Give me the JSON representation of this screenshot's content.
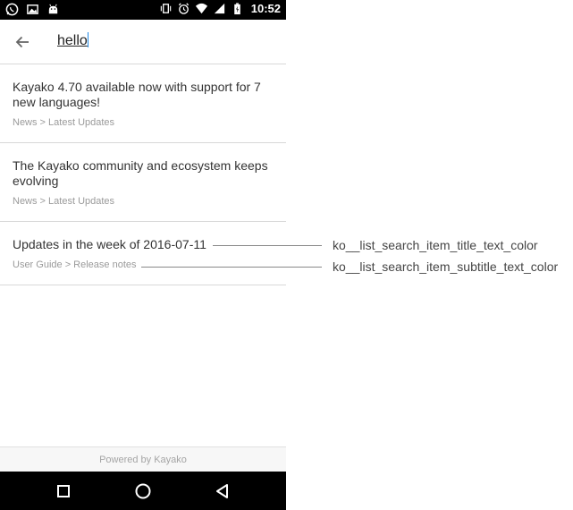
{
  "status_bar": {
    "time": "10:52",
    "left_icons": [
      "whatsapp-icon",
      "image-icon",
      "android-icon"
    ],
    "right_icons": [
      "vibrate-icon",
      "alarm-icon",
      "wifi-icon",
      "signal-icon",
      "battery-icon"
    ]
  },
  "search": {
    "query": "hello"
  },
  "results": [
    {
      "title": "Kayako 4.70 available now with support for 7 new languages!",
      "subtitle": "News > Latest Updates"
    },
    {
      "title": "The Kayako community and ecosystem keeps evolving",
      "subtitle": "News > Latest Updates"
    },
    {
      "title": "Updates in the week of 2016-07-11",
      "subtitle": "User Guide > Release notes"
    }
  ],
  "footer": {
    "text": "Powered by Kayako"
  },
  "annotations": {
    "title_color_label": "ko__list_search_item_title_text_color",
    "subtitle_color_label": "ko__list_search_item_subtitle_text_color"
  },
  "colors": {
    "title_text": "#333333",
    "subtitle_text": "#9a9a9a",
    "caret": "#1e88e5",
    "status_bar": "#000000"
  }
}
